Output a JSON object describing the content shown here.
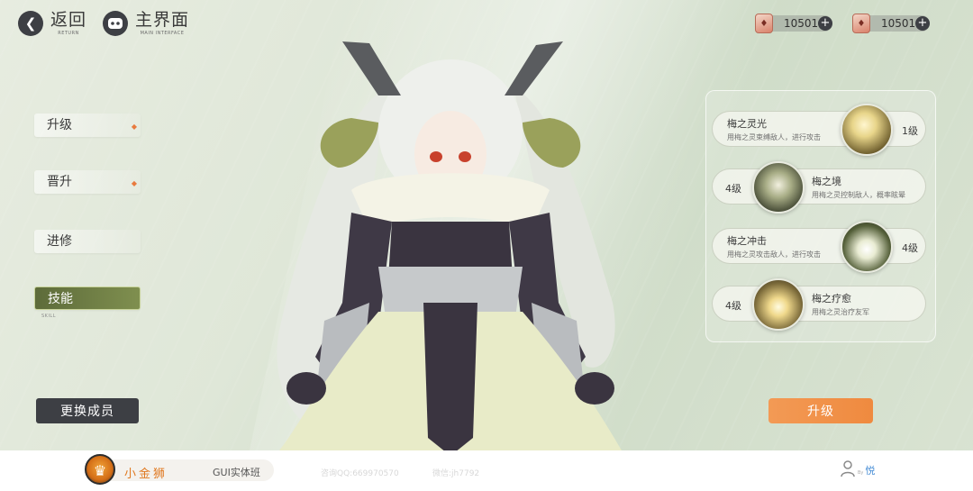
{
  "nav": {
    "back_label": "返回",
    "back_sub": "RETURN",
    "main_label": "主界面",
    "main_sub": "MAIN INTERFACE"
  },
  "currencies": [
    {
      "amount": "10501",
      "icon": "ticket-icon"
    },
    {
      "amount": "10501",
      "icon": "ticket-icon"
    }
  ],
  "menu": {
    "items": [
      {
        "label": "升级",
        "has_dot": true
      },
      {
        "label": "晋升",
        "has_dot": true
      },
      {
        "label": "进修",
        "has_dot": false
      },
      {
        "label": "技能",
        "has_dot": false,
        "selected": true
      }
    ],
    "selected_sub": "SKILL",
    "swap_label": "更换成员"
  },
  "skills": [
    {
      "name": "梅之灵光",
      "desc": "用梅之灵束缚敌人，进行攻击",
      "level": "1级"
    },
    {
      "name": "梅之境",
      "desc": "用梅之灵控制敌人，概率眩晕",
      "level": "4级"
    },
    {
      "name": "梅之冲击",
      "desc": "用梅之灵攻击敌人，进行攻击",
      "level": "4级"
    },
    {
      "name": "梅之疗愈",
      "desc": "用梅之灵治疗友军",
      "level": "4级"
    }
  ],
  "upgrade_label": "升级",
  "footer": {
    "brand_name": "小金狮",
    "class_name": "GUI实体班",
    "qq": "咨询QQ:669970570",
    "wechat": "微信:jh7792",
    "user_tag": "悦",
    "user_tiny": "By"
  },
  "colors": {
    "accent_orange": "#ef8a3f",
    "dark_button": "#3d3f44",
    "selected_green": "#6b7a44"
  }
}
